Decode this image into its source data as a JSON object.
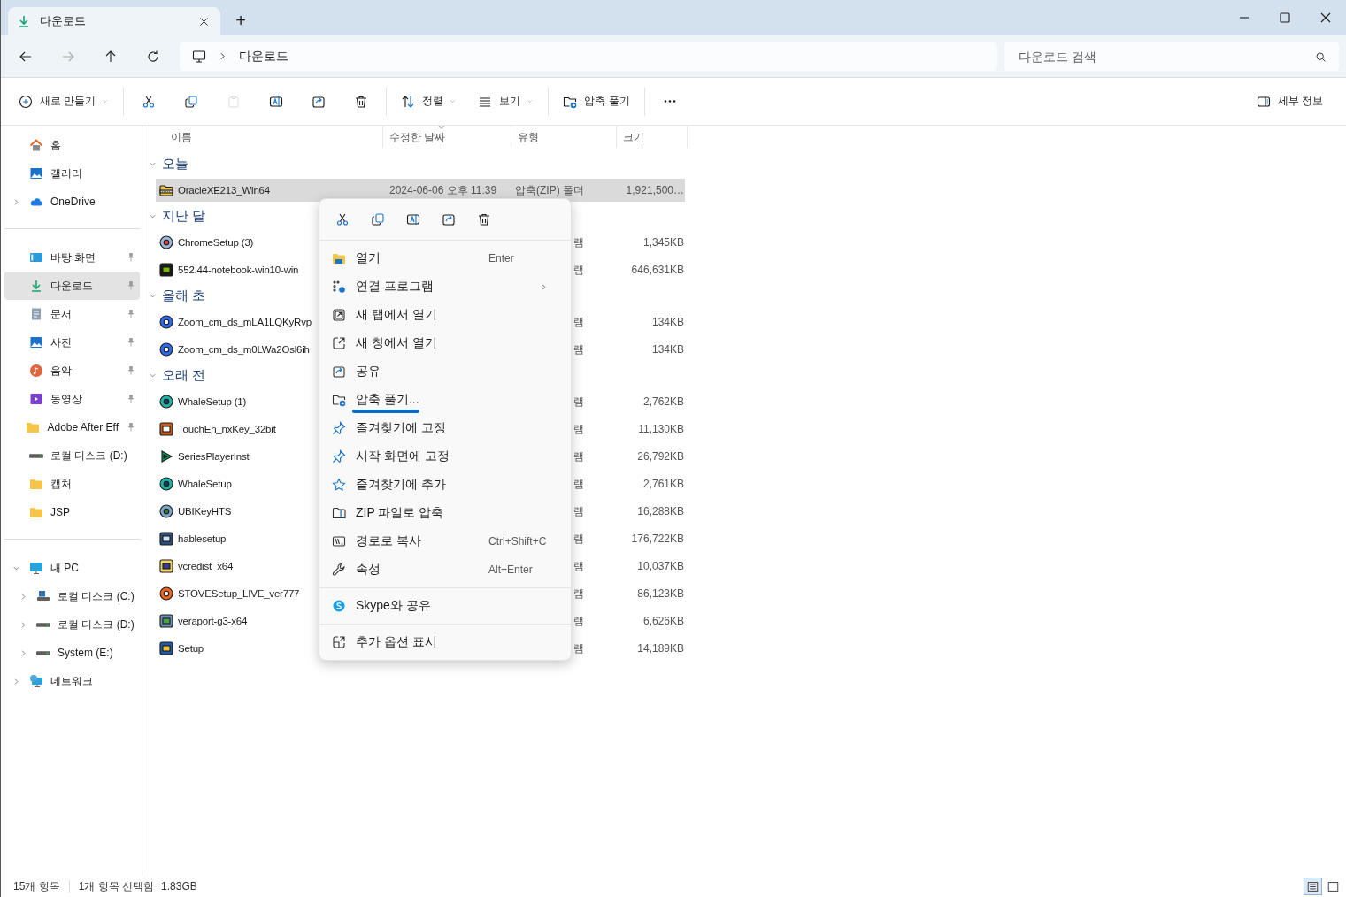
{
  "tab": {
    "title": "다운로드",
    "selected": true
  },
  "new_tab": "+",
  "nav_buttons": [
    {
      "disabled": false
    },
    {
      "disabled": true
    },
    {
      "disabled": false
    },
    {
      "disabled": false
    }
  ],
  "address": {
    "path": [
      "다운로드"
    ]
  },
  "search": {
    "placeholder": "다운로드 검색"
  },
  "toolbar": {
    "groups": [
      [
        {
          "kind": "menu",
          "label": "새로 만들기",
          "disabled": false
        }
      ],
      [
        {
          "kind": "icon",
          "disabled": false
        },
        {
          "kind": "icon",
          "disabled": false
        },
        {
          "kind": "icon",
          "disabled": true
        },
        {
          "kind": "icon",
          "disabled": false
        },
        {
          "kind": "icon",
          "disabled": false
        },
        {
          "kind": "icon",
          "disabled": false
        }
      ],
      [
        {
          "kind": "menu",
          "label": "정렬",
          "disabled": false
        },
        {
          "kind": "menu",
          "label": "보기",
          "disabled": false
        }
      ],
      [
        {
          "kind": "button",
          "label": "압축 풀기",
          "disabled": false
        }
      ],
      [
        {
          "kind": "icon",
          "disabled": false
        }
      ]
    ],
    "details": "세부 정보"
  },
  "sidebar": {
    "sections": [
      {
        "items": [
          {
            "label": "홈",
            "selected": false
          },
          {
            "label": "갤러리",
            "selected": false
          },
          {
            "label": "OneDrive",
            "selected": false,
            "expanded": false
          }
        ]
      },
      {
        "items": [
          {
            "label": "바탕 화면",
            "selected": false,
            "pinned": true
          },
          {
            "label": "다운로드",
            "selected": true,
            "pinned": true
          },
          {
            "label": "문서",
            "selected": false,
            "pinned": true
          },
          {
            "label": "사진",
            "selected": false,
            "pinned": true
          },
          {
            "label": "음악",
            "selected": false,
            "pinned": true
          },
          {
            "label": "동영상",
            "selected": false,
            "pinned": true
          },
          {
            "label": "Adobe After Eff",
            "selected": false,
            "pinned": true
          },
          {
            "label": "로컬 디스크 (D:)",
            "selected": false,
            "pinned": false
          },
          {
            "label": "캡처",
            "selected": false,
            "pinned": false
          },
          {
            "label": "JSP",
            "selected": false,
            "pinned": false
          }
        ]
      },
      {
        "items": [
          {
            "label": "내 PC",
            "selected": false,
            "expanded": true,
            "children": [
              {
                "label": "로컬 디스크 (C:)",
                "selected": false,
                "expanded": false
              },
              {
                "label": "로컬 디스크 (D:)",
                "selected": false,
                "expanded": false
              },
              {
                "label": "System (E:)",
                "selected": false,
                "expanded": false
              }
            ]
          },
          {
            "label": "네트워크",
            "selected": false,
            "expanded": false
          }
        ]
      }
    ]
  },
  "columns": [
    {
      "label": "이름",
      "sorted": false
    },
    {
      "label": "수정한 날짜",
      "sorted": true
    },
    {
      "label": "유형",
      "sorted": false
    },
    {
      "label": "크기",
      "sorted": false
    }
  ],
  "groups": [
    {
      "label": "오늘",
      "expanded": true,
      "rows": [
        {
          "name": "OracleXE213_Win64",
          "date": "2024-06-06 오후 11:39",
          "type": "압축(ZIP) 폴더",
          "size": "1,921,500…",
          "selected": true
        }
      ]
    },
    {
      "label": "지난 달",
      "expanded": true,
      "rows": [
        {
          "name": "ChromeSetup (3)",
          "type": "램",
          "size": "1,345KB",
          "selected": false
        },
        {
          "name": "552.44-notebook-win10-win",
          "type": "램",
          "size": "646,631KB",
          "selected": false
        }
      ]
    },
    {
      "label": "올해 초",
      "expanded": true,
      "rows": [
        {
          "name": "Zoom_cm_ds_mLA1LQKyRvp",
          "type": "램",
          "size": "134KB",
          "selected": false
        },
        {
          "name": "Zoom_cm_ds_m0LWa2Osl6ih",
          "type": "램",
          "size": "134KB",
          "selected": false
        }
      ]
    },
    {
      "label": "오래 전",
      "expanded": true,
      "rows": [
        {
          "name": "WhaleSetup (1)",
          "type": "램",
          "size": "2,762KB",
          "selected": false
        },
        {
          "name": "TouchEn_nxKey_32bit",
          "type": "램",
          "size": "11,130KB",
          "selected": false
        },
        {
          "name": "SeriesPlayerInst",
          "type": "램",
          "size": "26,792KB",
          "selected": false
        },
        {
          "name": "WhaleSetup",
          "type": "램",
          "size": "2,761KB",
          "selected": false
        },
        {
          "name": "UBIKeyHTS",
          "type": "램",
          "size": "16,288KB",
          "selected": false
        },
        {
          "name": "hablesetup",
          "type": "램",
          "size": "176,722KB",
          "selected": false
        },
        {
          "name": "vcredist_x64",
          "type": "램",
          "size": "10,037KB",
          "selected": false
        },
        {
          "name": "STOVESetup_LIVE_ver777",
          "type": "램",
          "size": "86,123KB",
          "selected": false
        },
        {
          "name": "veraport-g3-x64",
          "type": "램",
          "size": "6,626KB",
          "selected": false
        },
        {
          "name": "Setup",
          "type": "램",
          "size": "14,189KB",
          "selected": false
        }
      ]
    }
  ],
  "context_menu": {
    "sections": [
      [
        {
          "label": "열기",
          "shortcut": "Enter",
          "submenu": false,
          "focused": false
        },
        {
          "label": "연결 프로그램",
          "submenu": true,
          "focused": false
        },
        {
          "label": "새 탭에서 열기",
          "submenu": false,
          "focused": false
        },
        {
          "label": "새 창에서 열기",
          "submenu": false,
          "focused": false
        },
        {
          "label": "공유",
          "submenu": false,
          "focused": false
        },
        {
          "label": "압축 풀기...",
          "submenu": false,
          "focused": true
        },
        {
          "label": "즐겨찾기에 고정",
          "submenu": false,
          "focused": false
        },
        {
          "label": "시작 화면에 고정",
          "submenu": false,
          "focused": false
        },
        {
          "label": "즐겨찾기에 추가",
          "submenu": false,
          "focused": false
        },
        {
          "label": "ZIP 파일로 압축",
          "submenu": false,
          "focused": false
        },
        {
          "label": "경로로 복사",
          "shortcut": "Ctrl+Shift+C",
          "submenu": false,
          "focused": false
        },
        {
          "label": "속성",
          "shortcut": "Alt+Enter",
          "submenu": false,
          "focused": false
        }
      ],
      [
        {
          "label": "Skype와 공유",
          "submenu": false,
          "focused": false
        }
      ],
      [
        {
          "label": "추가 옵션 표시",
          "submenu": false,
          "focused": false
        }
      ]
    ]
  },
  "status_bar": {
    "count": "15개 항목",
    "selection": "1개 항목 선택함",
    "size": "1.83GB",
    "views": [
      {
        "selected": true
      },
      {
        "selected": false
      }
    ]
  }
}
